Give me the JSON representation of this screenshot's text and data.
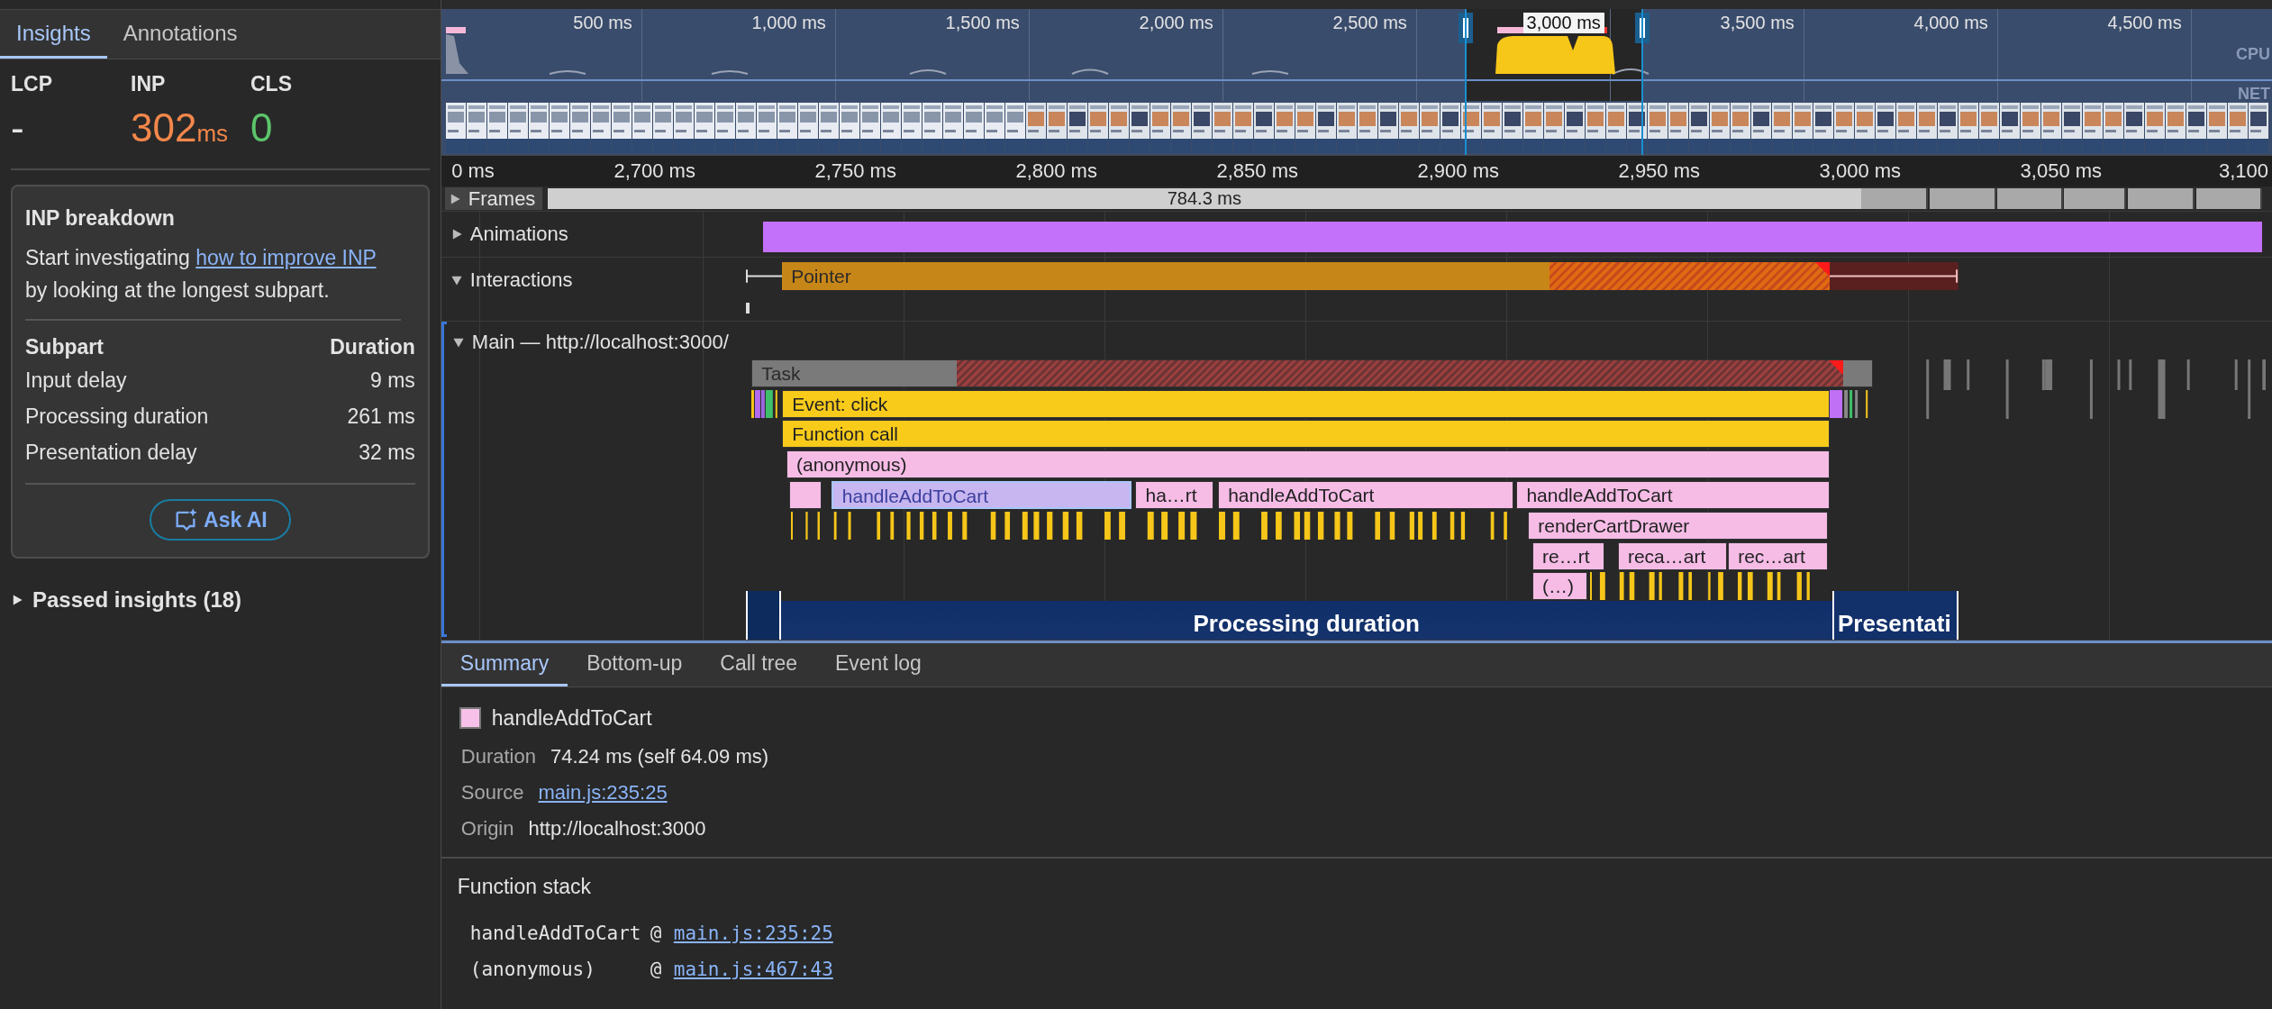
{
  "sidebar": {
    "tabs": [
      {
        "label": "Insights",
        "selected": true
      },
      {
        "label": "Annotations",
        "selected": false
      }
    ],
    "metrics": [
      {
        "name": "LCP",
        "value": "-",
        "color": "#e3e3e3"
      },
      {
        "name": "INP",
        "value": "302",
        "unit": "ms",
        "color": "#f4874b"
      },
      {
        "name": "CLS",
        "value": "0",
        "color": "#5cc46b"
      }
    ],
    "insight": {
      "title": "INP breakdown",
      "text_before": "Start investigating ",
      "link": "how to improve INP",
      "text_after": " by looking at the longest subpart.",
      "columns": [
        "Subpart",
        "Duration"
      ],
      "rows": [
        {
          "subpart": "Input delay",
          "duration": "9 ms"
        },
        {
          "subpart": "Processing duration",
          "duration": "261 ms"
        },
        {
          "subpart": "Presentation delay",
          "duration": "32 ms"
        }
      ],
      "button": "Ask AI"
    },
    "passed_insights": {
      "label": "Passed insights (18)",
      "expanded": false
    }
  },
  "overview": {
    "ticks": [
      {
        "label": "500 ms",
        "selected": false
      },
      {
        "label": "1,000 ms",
        "selected": false
      },
      {
        "label": "1,500 ms",
        "selected": false
      },
      {
        "label": "2,000 ms",
        "selected": false
      },
      {
        "label": "2,500 ms",
        "selected": false
      },
      {
        "label": "3,000 ms",
        "selected": true
      },
      {
        "label": "3,500 ms",
        "selected": false
      },
      {
        "label": "4,000 ms",
        "selected": false
      },
      {
        "label": "4,500 ms",
        "selected": false
      }
    ],
    "lanes": [
      "CPU",
      "NET"
    ]
  },
  "timeline": {
    "ruler": [
      "0 ms",
      "2,700 ms",
      "2,750 ms",
      "2,800 ms",
      "2,850 ms",
      "2,900 ms",
      "2,950 ms",
      "3,000 ms",
      "3,050 ms",
      "3,100"
    ],
    "tracks": [
      {
        "kind": "frames",
        "name": "Frames",
        "expanded": false,
        "duration": "784.3 ms"
      },
      {
        "kind": "animations",
        "name": "Animations",
        "expanded": false
      },
      {
        "kind": "interactions",
        "name": "Interactions",
        "expanded": true,
        "interaction": "Pointer"
      },
      {
        "kind": "main",
        "name": "Main — http://localhost:3000/",
        "expanded": true,
        "flame": [
          [
            {
              "label": "Task",
              "kind": "task",
              "selected": false
            }
          ],
          [
            {
              "label": "Event: click",
              "kind": "event",
              "selected": false
            }
          ],
          [
            {
              "label": "Function call",
              "kind": "event",
              "selected": false
            }
          ],
          [
            {
              "label": "(anonymous)",
              "kind": "function",
              "selected": false
            }
          ],
          [
            {
              "kind": "function",
              "selected": false
            },
            {
              "label": "handleAddToCart",
              "kind": "function",
              "selected": true
            },
            {
              "label": "ha…rt",
              "kind": "function",
              "selected": false
            },
            {
              "label": "handleAddToCart",
              "kind": "function",
              "selected": false
            },
            {
              "label": "handleAddToCart",
              "kind": "function",
              "selected": false
            }
          ],
          [
            {
              "label": "renderCartDrawer",
              "kind": "function",
              "selected": false
            }
          ],
          [
            {
              "label": "re…rt",
              "kind": "function",
              "selected": false
            },
            {
              "label": "reca…art",
              "kind": "function",
              "selected": false
            },
            {
              "label": "rec…art",
              "kind": "function",
              "selected": false
            }
          ],
          [
            {
              "label": "(…)",
              "kind": "function",
              "selected": false
            }
          ]
        ],
        "phases": [
          {
            "kind": "input-delay"
          },
          {
            "kind": "processing",
            "label": "Processing duration"
          },
          {
            "kind": "presentation",
            "label": "Presentati"
          }
        ]
      }
    ]
  },
  "details": {
    "tabs": [
      {
        "label": "Summary",
        "selected": true
      },
      {
        "label": "Bottom-up",
        "selected": false
      },
      {
        "label": "Call tree",
        "selected": false
      },
      {
        "label": "Event log",
        "selected": false
      }
    ],
    "summary": {
      "title": "handleAddToCart",
      "color": "#f7c0e8",
      "fields": [
        {
          "label": "Duration",
          "value": "74.24 ms (self 64.09 ms)",
          "kind": "text"
        },
        {
          "label": "Source",
          "value": "main.js:235:25",
          "kind": "link"
        },
        {
          "label": "Origin",
          "value": "http://localhost:3000",
          "kind": "text"
        }
      ]
    },
    "function_stack": {
      "title": "Function stack",
      "frames": [
        {
          "name": "handleAddToCart",
          "at": "@",
          "location": "main.js:235:25"
        },
        {
          "name": "(anonymous)",
          "at": "@",
          "location": "main.js:467:43"
        }
      ]
    }
  }
}
